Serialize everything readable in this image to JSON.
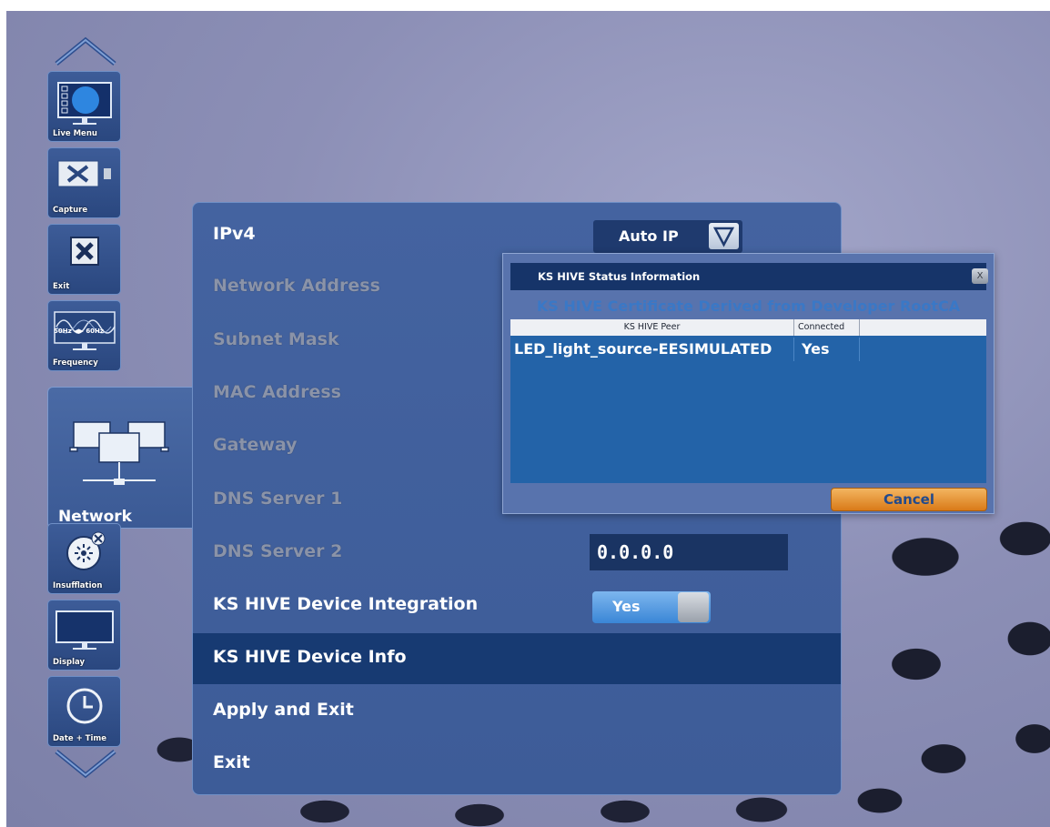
{
  "sidebar": {
    "items": [
      {
        "label": "Live Menu",
        "icon": "monitor-icon"
      },
      {
        "label": "Capture",
        "icon": "tools-icon"
      },
      {
        "label": "Exit",
        "icon": "exit-x-icon"
      },
      {
        "label": "Frequency",
        "icon": "sine-wave-icon",
        "caption": "50Hz ◀▶ 60Hz"
      },
      {
        "label": "Network",
        "icon": "network-icon"
      },
      {
        "label": "Insufflation",
        "icon": "insufflation-icon"
      },
      {
        "label": "Display",
        "icon": "display-icon"
      },
      {
        "label": "Date + Time",
        "icon": "clock-icon"
      }
    ]
  },
  "panel": {
    "rows": [
      {
        "label": "IPv4",
        "enabled": true
      },
      {
        "label": "Network Address",
        "enabled": false
      },
      {
        "label": "Subnet Mask",
        "enabled": false
      },
      {
        "label": "MAC Address",
        "enabled": false
      },
      {
        "label": "Gateway",
        "enabled": false
      },
      {
        "label": "DNS Server 1",
        "enabled": false
      },
      {
        "label": "DNS Server 2",
        "enabled": false
      },
      {
        "label": "KS HIVE Device Integration",
        "enabled": true
      },
      {
        "label": "KS HIVE Device Info",
        "enabled": true,
        "selected": true
      },
      {
        "label": "Apply and Exit",
        "enabled": true
      },
      {
        "label": "Exit",
        "enabled": true
      }
    ],
    "ipv4_mode": "Auto IP",
    "dns2_value": "0.0.0.0",
    "hive_integration_toggle": "Yes"
  },
  "dialog": {
    "title": "KS HIVE Status Information",
    "close_label": "X",
    "certificate": "KS HIVE Certificate Derived from Developer RootCA",
    "columns": [
      "KS HIVE Peer",
      "Connected"
    ],
    "rows": [
      {
        "peer": "LED_light_source-EESIMULATED",
        "connected": "Yes"
      }
    ],
    "cancel_label": "Cancel"
  },
  "colors": {
    "panel": "#3d5c98",
    "selected_row": "#173a72",
    "cancel_button": "#e8922f",
    "toggle_on": "#4a90dd"
  }
}
